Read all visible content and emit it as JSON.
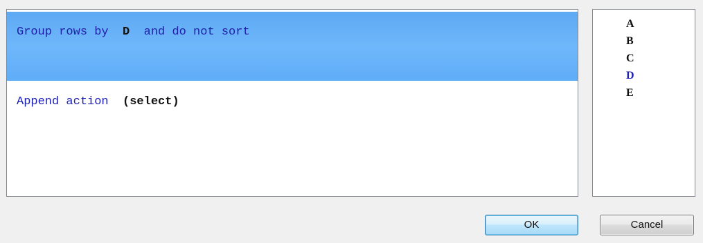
{
  "actions": [
    {
      "keyword_before": "Group rows by",
      "value": "D",
      "keyword_after": "and do not sort",
      "selected": true
    },
    {
      "keyword_before": "Append action",
      "value": "(select)",
      "selected": false
    }
  ],
  "columns": {
    "items": [
      "A",
      "B",
      "C",
      "D",
      "E"
    ],
    "active": "D"
  },
  "buttons": {
    "ok_label": "OK",
    "cancel_label": "Cancel"
  },
  "colors": {
    "selection": "#6fb7fb",
    "keyword": "#1e21b4",
    "dialog_background": "#f0f0f0"
  }
}
